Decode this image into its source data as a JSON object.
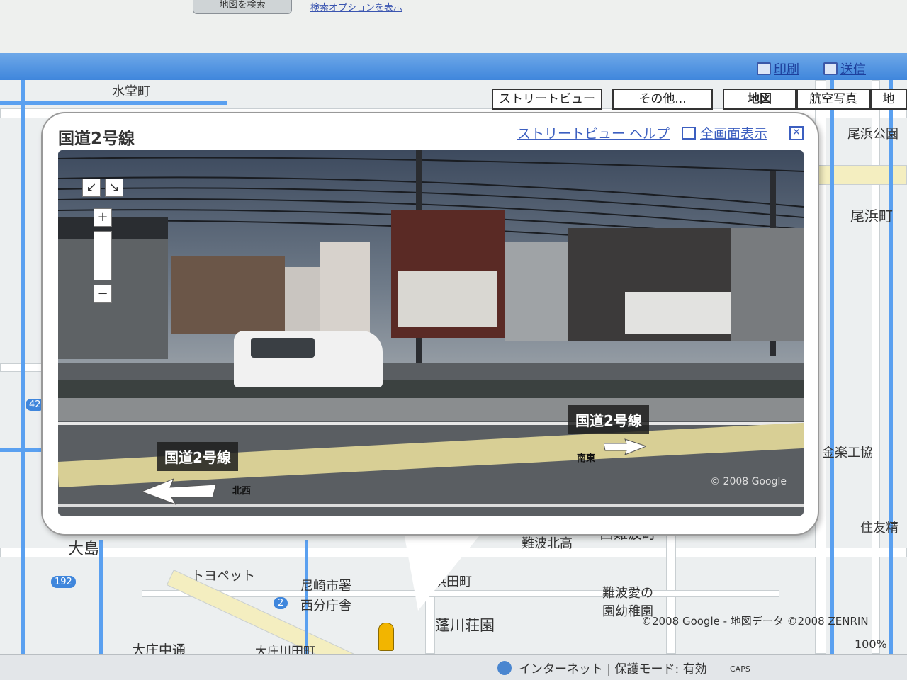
{
  "browser": {
    "search_button": "地図を検索",
    "options_link": "検索オプションを表示"
  },
  "toolbar": {
    "print_label": "印刷",
    "send_label": "送信"
  },
  "map_types": [
    "ストリートビュー",
    "その他...",
    "地図",
    "航空写真",
    "地"
  ],
  "map_labels": [
    "水堂町",
    "尾浜公園",
    "尾浜町",
    "大島",
    "トヨペット",
    "尼崎市署",
    "西分庁舎",
    "浜田町",
    "蓬川荘園",
    "難波北高",
    "西難波町",
    "難波愛の",
    "園幼稚園",
    "金楽工協",
    "住友精",
    "大庄中通",
    "大庄川田町",
    "192",
    "2",
    "42"
  ],
  "popup": {
    "title": "国道2号線",
    "help_link": "ストリートビュー ヘルプ",
    "fullscreen_link": "全画面表示",
    "close_symbol": "✕"
  },
  "streetview": {
    "tag_left": "国道2号線",
    "tag_right": "国道2号線",
    "dir_left": "北西",
    "dir_right": "南東",
    "copyright": "© 2008 Google",
    "zoom_in": "+",
    "zoom_out": "−",
    "pan_left": "↙",
    "pan_right": "↘"
  },
  "map_copyright": "©2008 Google - 地図データ ©2008 ZENRIN",
  "status": {
    "zone": "インターネット | 保護モード: 有効",
    "zoom": "100%",
    "caps": "CAPS"
  }
}
